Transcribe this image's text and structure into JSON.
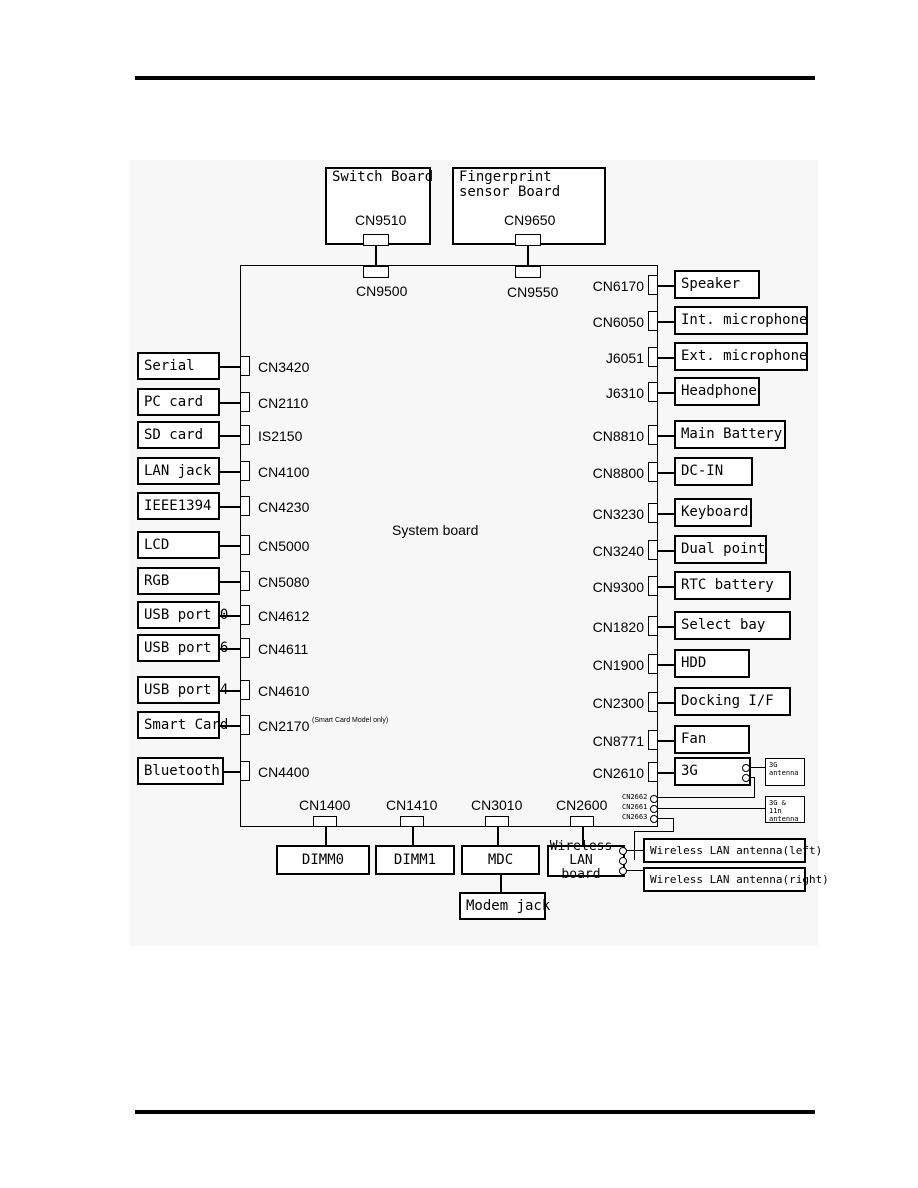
{
  "title": "System board",
  "top": [
    {
      "device": "Switch Board",
      "device_conn": "CN9510",
      "board_conn": "CN9500"
    },
    {
      "device": "Fingerprint sensor Board",
      "device_conn": "CN9650",
      "board_conn": "CN9550"
    }
  ],
  "left": [
    {
      "device": "Serial",
      "conn": "CN3420"
    },
    {
      "device": "PC card",
      "conn": "CN2110"
    },
    {
      "device": "SD card",
      "conn": "IS2150"
    },
    {
      "device": "LAN jack",
      "conn": "CN4100"
    },
    {
      "device": "IEEE1394",
      "conn": "CN4230"
    },
    {
      "device": "LCD",
      "conn": "CN5000"
    },
    {
      "device": "RGB",
      "conn": "CN5080"
    },
    {
      "device": "USB port 0",
      "conn": "CN4612"
    },
    {
      "device": "USB port 6",
      "conn": "CN4611"
    },
    {
      "device": "USB port 4",
      "conn": "CN4610"
    },
    {
      "device": "Smart Card",
      "conn": "CN2170"
    },
    {
      "device": "Bluetooth",
      "conn": "CN4400"
    }
  ],
  "smart_card_note": "(Smart Card Model only)",
  "right": [
    {
      "device": "Speaker",
      "conn": "CN6170"
    },
    {
      "device": "Int. microphone",
      "conn": "CN6050"
    },
    {
      "device": "Ext. microphone",
      "conn": "J6051"
    },
    {
      "device": "Headphone",
      "conn": "J6310"
    },
    {
      "device": "Main Battery",
      "conn": "CN8810"
    },
    {
      "device": "DC-IN",
      "conn": "CN8800"
    },
    {
      "device": "Keyboard",
      "conn": "CN3230"
    },
    {
      "device": "Dual point",
      "conn": "CN3240"
    },
    {
      "device": "RTC battery",
      "conn": "CN9300"
    },
    {
      "device": "Select bay",
      "conn": "CN1820"
    },
    {
      "device": "HDD",
      "conn": "CN1900"
    },
    {
      "device": "Docking I/F",
      "conn": "CN2300"
    },
    {
      "device": "Fan",
      "conn": "CN8771"
    },
    {
      "device": "3G",
      "conn": "CN2610"
    }
  ],
  "antenna_conns": [
    "CN2662",
    "CN2661",
    "CN2663"
  ],
  "antennas": [
    "3G antenna",
    "3G & 11n antenna",
    "Wireless LAN antenna(left)",
    "Wireless LAN antenna(right)"
  ],
  "bottom": [
    {
      "device": "DIMM0",
      "conn": "CN1400"
    },
    {
      "device": "DIMM1",
      "conn": "CN1410"
    },
    {
      "device": "MDC",
      "conn": "CN3010"
    },
    {
      "device": "Wireless LAN board",
      "conn": "CN2600"
    }
  ],
  "modem": "Modem jack"
}
